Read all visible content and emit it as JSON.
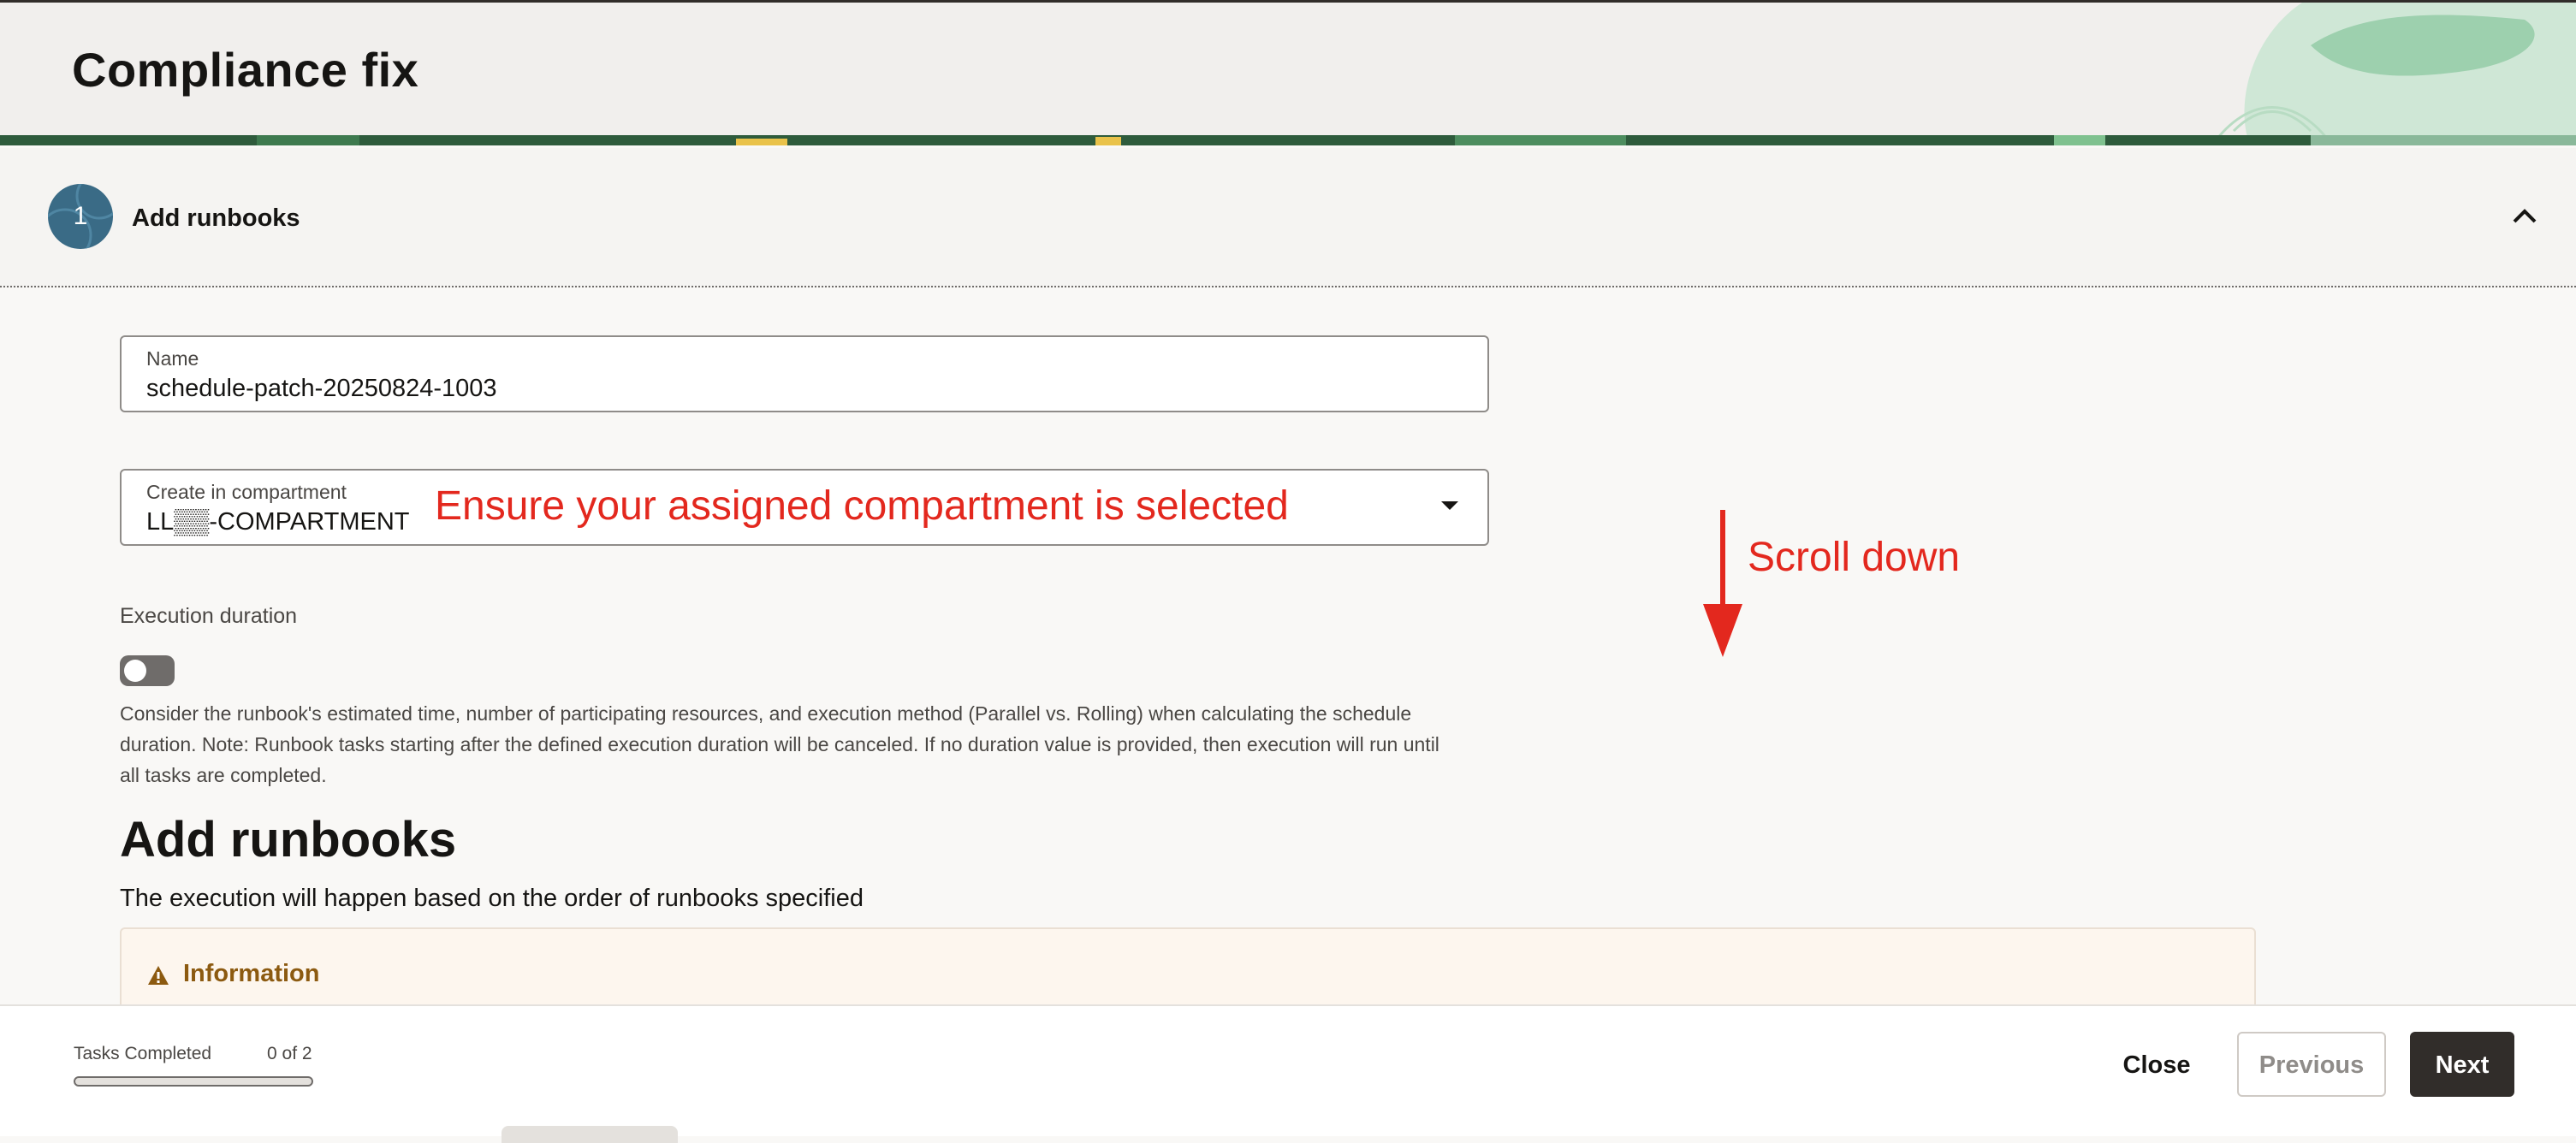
{
  "header": {
    "title": "Compliance fix"
  },
  "step": {
    "number": "1",
    "title": "Add runbooks",
    "chevron_icon": "chevron-up-icon"
  },
  "form": {
    "name": {
      "label": "Name",
      "value": "schedule-patch-20250824-1003"
    },
    "compartment": {
      "label": "Create in compartment",
      "value": "LL▒▒-COMPARTMENT",
      "annotation": "Ensure your assigned compartment is selected",
      "caret_icon": "caret-down-icon"
    },
    "execution_duration": {
      "label": "Execution duration",
      "toggle_on": false,
      "help": "Consider the runbook's estimated time, number of participating resources, and execution method (Parallel vs. Rolling) when calculating the schedule duration. Note: Runbook tasks starting after the defined execution duration will be canceled. If no duration value is provided, then execution will run until all tasks are completed."
    }
  },
  "section": {
    "title": "Add runbooks",
    "subtitle": "The execution will happen based on the order of runbooks specified",
    "info": {
      "icon": "warning-icon",
      "title": "Information"
    }
  },
  "scroll_annotation": {
    "text": "Scroll down",
    "icon": "arrow-down-icon"
  },
  "footer": {
    "tasks_label": "Tasks Completed",
    "tasks_count": "0 of 2",
    "progress_fraction": 0,
    "close_label": "Close",
    "previous_label": "Previous",
    "next_label": "Next"
  },
  "colors": {
    "accent": "#3a6b86",
    "annotation": "#e3281e",
    "primary_button": "#312d2a",
    "warning": "#8c5a10"
  }
}
